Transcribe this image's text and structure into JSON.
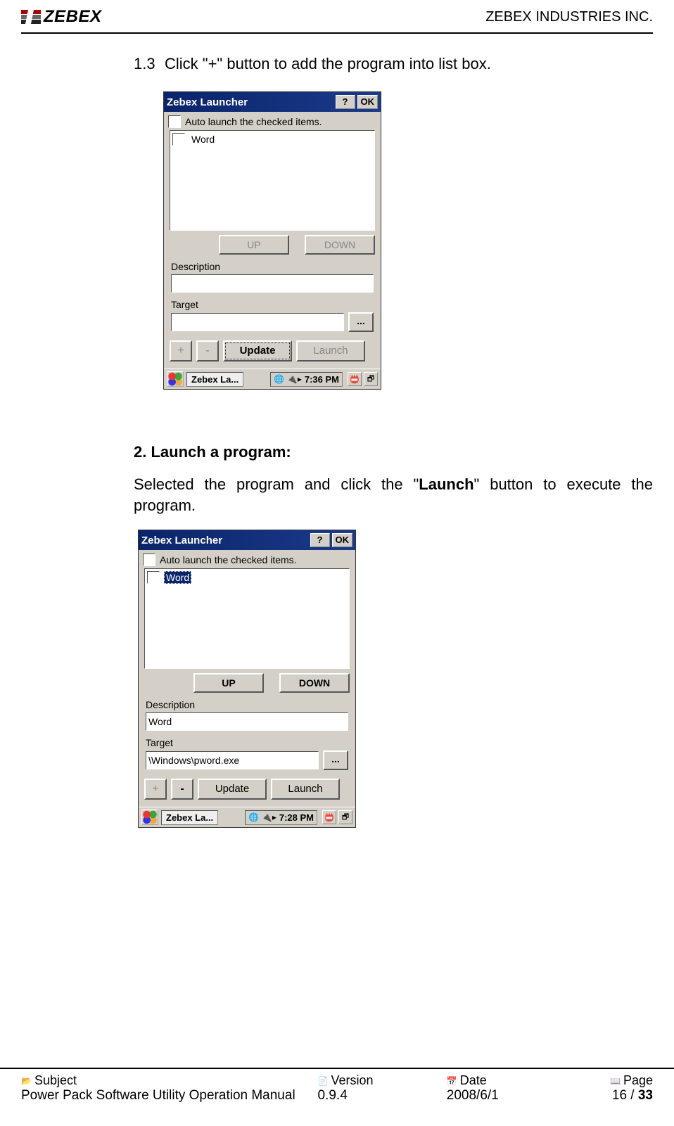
{
  "header": {
    "logo_text": "ZEBEX",
    "company": "ZEBEX INDUSTRIES INC."
  },
  "step": {
    "num": "1.3",
    "text": "Click \"+\" button to add the program into list box."
  },
  "section2": {
    "heading_num": "2.",
    "heading_text": "Launch a program:",
    "body_pre": "Selected the program and click the \"",
    "body_bold": "Launch",
    "body_post": "\" button to execute the program."
  },
  "win": {
    "title": "Zebex Launcher",
    "help": "?",
    "ok": "OK",
    "auto_label": "Auto launch the checked items.",
    "up": "UP",
    "down": "DOWN",
    "desc_label": "Description",
    "target_label": "Target",
    "browse": "...",
    "plus": "+",
    "minus": "-",
    "update": "Update",
    "launch": "Launch"
  },
  "shot1": {
    "list_item": "Word",
    "desc_value": "",
    "target_value": "",
    "task": "Zebex La...",
    "time": "7:36 PM"
  },
  "shot2": {
    "list_item": "Word",
    "desc_value": "Word",
    "target_value": "\\Windows\\pword.exe",
    "task": "Zebex La...",
    "time": "7:28 PM"
  },
  "footer": {
    "subject_label": "Subject",
    "subject_value": "Power Pack Software Utility Operation Manual",
    "version_label": "Version",
    "version_value": "0.9.4",
    "date_label": "Date",
    "date_value": "2008/6/1",
    "page_label": "Page",
    "page_value_a": "16 / ",
    "page_value_b": "33"
  }
}
